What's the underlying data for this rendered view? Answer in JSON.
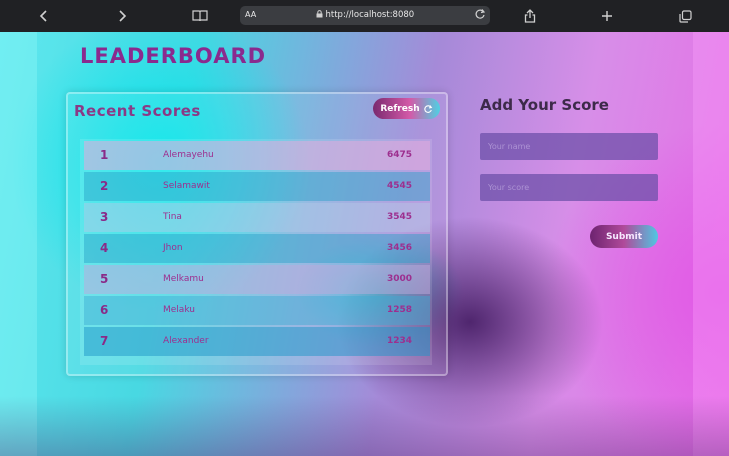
{
  "browser": {
    "aa_label": "AA",
    "url": "http://localhost:8080"
  },
  "page": {
    "title": "LEADERBOARD"
  },
  "recent_scores": {
    "heading": "Recent Scores",
    "refresh_label": "Refresh",
    "rows": [
      {
        "rank": "1",
        "name": "Alemayehu",
        "score": "6475"
      },
      {
        "rank": "2",
        "name": "Selamawit",
        "score": "4545"
      },
      {
        "rank": "3",
        "name": "Tina",
        "score": "3545"
      },
      {
        "rank": "4",
        "name": "Jhon",
        "score": "3456"
      },
      {
        "rank": "5",
        "name": "Melkamu",
        "score": "3000"
      },
      {
        "rank": "6",
        "name": "Melaku",
        "score": "1258"
      },
      {
        "rank": "7",
        "name": "Alexander",
        "score": "1234"
      }
    ]
  },
  "add_score": {
    "heading": "Add Your Score",
    "name_placeholder": "Your name",
    "score_placeholder": "Your score",
    "submit_label": "Submit"
  }
}
